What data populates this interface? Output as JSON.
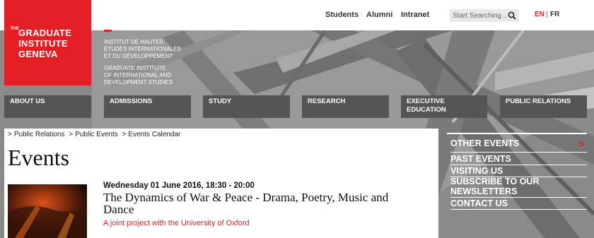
{
  "topnav": {
    "students": "Students",
    "alumni": "Alumni",
    "intranet": "Intranet"
  },
  "search": {
    "placeholder": "Start Searching ..."
  },
  "lang": {
    "en": "EN",
    "sep": "|",
    "fr": "FR"
  },
  "logo": {
    "the": "THE",
    "line1": "GRADUATE",
    "line2": "INSTITUTE",
    "line3": "GENEVA"
  },
  "institute": {
    "fr1": "INSTITUT DE HAUTES",
    "fr2": "ÉTUDES INTERNATIONALES",
    "fr3": "ET DU DÉVELOPPEMENT",
    "en1": "GRADUATE INSTITUTE",
    "en2": "OF INTERNATIONAL AND",
    "en3": "DEVELOPMENT STUDIES"
  },
  "mainnav": [
    {
      "label": "ABOUT US"
    },
    {
      "label": "ADMISSIONS"
    },
    {
      "label": "STUDY"
    },
    {
      "label": "RESEARCH"
    },
    {
      "label": "EXECUTIVE EDUCATION"
    },
    {
      "label": "PUBLIC RELATIONS"
    }
  ],
  "breadcrumb": [
    {
      "sep": ">",
      "label": "Public Relations"
    },
    {
      "sep": ">",
      "label": "Public Events"
    },
    {
      "sep": ">",
      "label": "Events Calendar"
    }
  ],
  "page": {
    "title": "Events"
  },
  "event": {
    "date": "Wednesday 01 June 2016, 18:30 - 20:00",
    "title": "The Dynamics of War & Peace - Drama, Poetry, Music and Dance",
    "subtitle": "A joint project with the University of Oxford"
  },
  "sidebar": [
    {
      "label": "OTHER EVENTS"
    },
    {
      "label": "PAST EVENTS"
    },
    {
      "label": "VISITING US"
    },
    {
      "label": "SUBSCRIBE TO OUR NEWSLETTERS"
    },
    {
      "label": "CONTACT US"
    }
  ],
  "colors": {
    "brand_red": "#e31e24",
    "nav_grey": "#555555",
    "hero_grey": "#8e8e8e"
  }
}
